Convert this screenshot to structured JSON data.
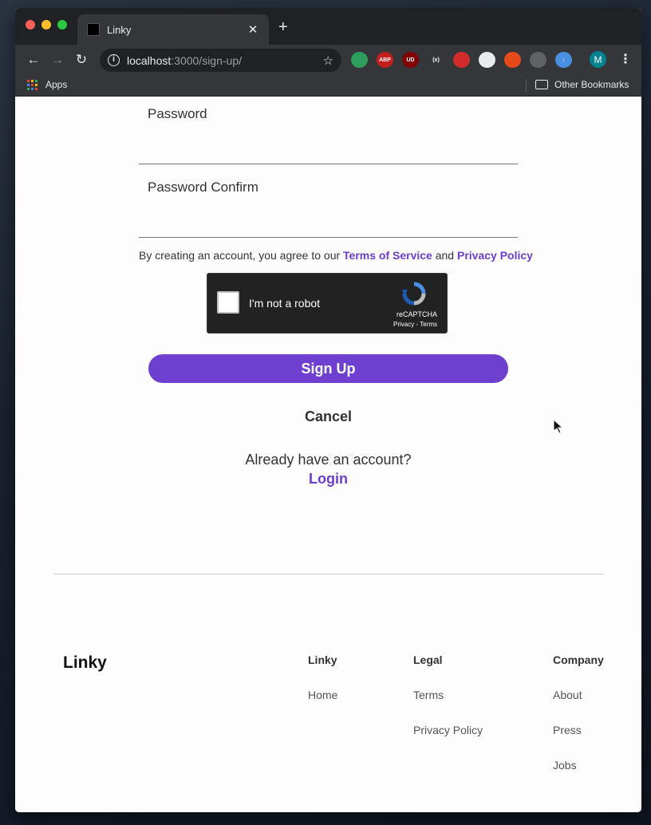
{
  "browser": {
    "tab_title": "Linky",
    "tab_close": "✕",
    "new_tab": "+",
    "back": "←",
    "forward": "→",
    "reload": "↻",
    "url_host": "localhost",
    "url_rest": ":3000/sign-up/",
    "star": "☆",
    "extensions": [
      {
        "name": "ext-circle-icon",
        "label": "",
        "color": "#2e9e5e"
      },
      {
        "name": "abp-icon",
        "label": "ABP",
        "color": "#c21e1e"
      },
      {
        "name": "ublock-icon",
        "label": "UD",
        "color": "#800000"
      },
      {
        "name": "xpath-icon",
        "label": "(x)",
        "color": "#35363a"
      },
      {
        "name": "ext-red-icon",
        "label": "",
        "color": "#d22b2b"
      },
      {
        "name": "ext-egg-icon",
        "label": "",
        "color": "#e8eaed"
      },
      {
        "name": "color-wheel-icon",
        "label": "",
        "color": "#e64a19"
      },
      {
        "name": "ext-stripes-icon",
        "label": "",
        "color": "#5f6368"
      },
      {
        "name": "download-icon",
        "label": "↓",
        "color": "#4a90e2"
      }
    ],
    "avatar": "M",
    "menu": "⋮",
    "apps_label": "Apps",
    "other_bookmarks": "Other Bookmarks"
  },
  "form": {
    "password_label": "Password",
    "password_confirm_label": "Password Confirm",
    "agree_prefix": "By creating an account, you agree to our ",
    "terms_link": "Terms of Service",
    "agree_and": " and ",
    "privacy_link": "Privacy Policy",
    "captcha_label": "I'm not a robot",
    "captcha_brand": "reCAPTCHA",
    "captcha_links": "Privacy - Terms",
    "signup_button": "Sign Up",
    "cancel": "Cancel",
    "already_text": "Already have an account?",
    "login_link": "Login"
  },
  "footer": {
    "brand": "Linky",
    "columns": [
      {
        "heading": "Linky",
        "links": [
          "Home"
        ]
      },
      {
        "heading": "Legal",
        "links": [
          "Terms",
          "Privacy Policy"
        ]
      },
      {
        "heading": "Company",
        "links": [
          "About",
          "Press",
          "Jobs"
        ]
      }
    ]
  },
  "colors": {
    "accent": "#6f3fcf",
    "link": "#6c3fc9"
  }
}
